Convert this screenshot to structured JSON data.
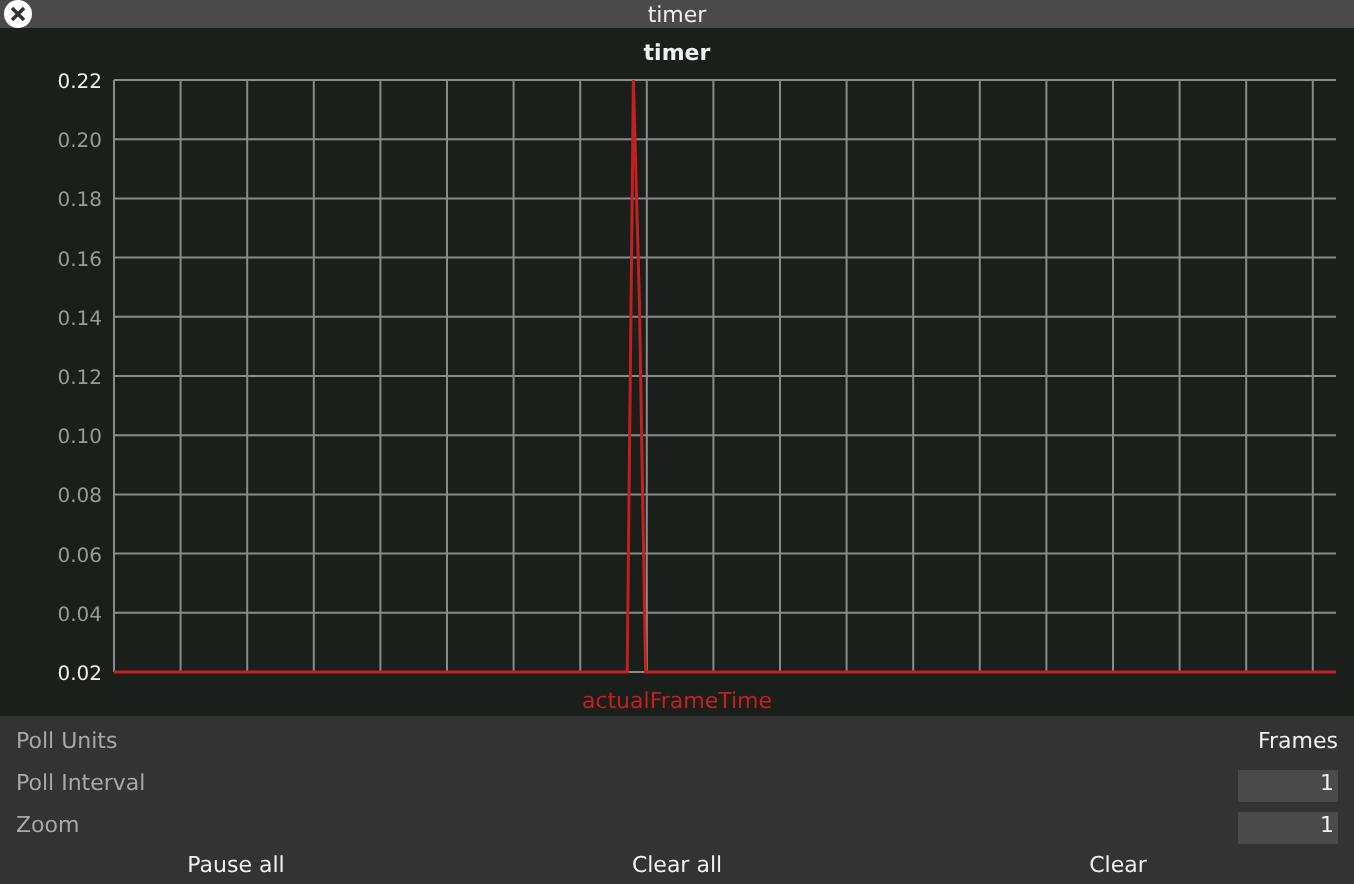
{
  "window": {
    "title": "timer"
  },
  "chart": {
    "chart_data": {
      "type": "line",
      "title": "timer",
      "grid": true,
      "ylim": [
        0.02,
        0.22
      ],
      "yticks": [
        {
          "value": 0.02,
          "label": "0.02"
        },
        {
          "value": 0.04,
          "label": "0.04"
        },
        {
          "value": 0.06,
          "label": "0.06"
        },
        {
          "value": 0.08,
          "label": "0.08"
        },
        {
          "value": 0.1,
          "label": "0.10"
        },
        {
          "value": 0.12,
          "label": "0.12"
        },
        {
          "value": 0.14,
          "label": "0.14"
        },
        {
          "value": 0.16,
          "label": "0.16"
        },
        {
          "value": 0.18,
          "label": "0.18"
        },
        {
          "value": 0.2,
          "label": "0.20"
        },
        {
          "value": 0.22,
          "label": "0.22"
        }
      ],
      "series": [
        {
          "name": "actualFrameTime",
          "color": "#c42020",
          "values": [
            0.02,
            0.02,
            0.02,
            0.02,
            0.02,
            0.02,
            0.02,
            0.02,
            0.02,
            0.02,
            0.02,
            0.02,
            0.02,
            0.02,
            0.02,
            0.02,
            0.02,
            0.02,
            0.02,
            0.02,
            0.02,
            0.02,
            0.02,
            0.02,
            0.02,
            0.02,
            0.02,
            0.02,
            0.02,
            0.02,
            0.02,
            0.02,
            0.02,
            0.02,
            0.02,
            0.02,
            0.02,
            0.02,
            0.02,
            0.02,
            0.02,
            0.02,
            0.02,
            0.02,
            0.02,
            0.02,
            0.02,
            0.02,
            0.02,
            0.02,
            0.02,
            0.02,
            0.02,
            0.02,
            0.02,
            0.02,
            0.02,
            0.02,
            0.02,
            0.02,
            0.02,
            0.02,
            0.02,
            0.02,
            0.02,
            0.02,
            0.02,
            0.02,
            0.02,
            0.02,
            0.02,
            0.02,
            0.02,
            0.02,
            0.02,
            0.02,
            0.02,
            0.02,
            0.02,
            0.02,
            0.02,
            0.02,
            0.02,
            0.02,
            0.02,
            0.22,
            0.145,
            0.02,
            0.02,
            0.02,
            0.02,
            0.02,
            0.02,
            0.02,
            0.02,
            0.02,
            0.02,
            0.02,
            0.02,
            0.02,
            0.02,
            0.02,
            0.02,
            0.02,
            0.02,
            0.02,
            0.02,
            0.02,
            0.02,
            0.02,
            0.02,
            0.02,
            0.02,
            0.02,
            0.02,
            0.02,
            0.02,
            0.02,
            0.02,
            0.02,
            0.02,
            0.02,
            0.02,
            0.02,
            0.02,
            0.02,
            0.02,
            0.02,
            0.02,
            0.02,
            0.02,
            0.02,
            0.02,
            0.02,
            0.02,
            0.02,
            0.02,
            0.02,
            0.02,
            0.02,
            0.02,
            0.02,
            0.02,
            0.02,
            0.02,
            0.02,
            0.02,
            0.02,
            0.02,
            0.02,
            0.02,
            0.02,
            0.02,
            0.02,
            0.02,
            0.02,
            0.02,
            0.02,
            0.02,
            0.02,
            0.02,
            0.02,
            0.02,
            0.02,
            0.02,
            0.02,
            0.02,
            0.02,
            0.02,
            0.02,
            0.02,
            0.02,
            0.02,
            0.02,
            0.02,
            0.02,
            0.02,
            0.02,
            0.02,
            0.02,
            0.02,
            0.02,
            0.02,
            0.02,
            0.02,
            0.02,
            0.02,
            0.02,
            0.02,
            0.02,
            0.02,
            0.02,
            0.02,
            0.02,
            0.02,
            0.02,
            0.02,
            0.02,
            0.02,
            0.02,
            0.02
          ]
        }
      ]
    }
  },
  "settings": [
    {
      "label": "Poll Units",
      "kind": "text",
      "value": "Frames"
    },
    {
      "label": "Poll Interval",
      "kind": "field",
      "value": "1"
    },
    {
      "label": "Zoom",
      "kind": "field",
      "value": "1"
    }
  ],
  "buttons": [
    "Pause all",
    "Clear all",
    "Clear"
  ]
}
